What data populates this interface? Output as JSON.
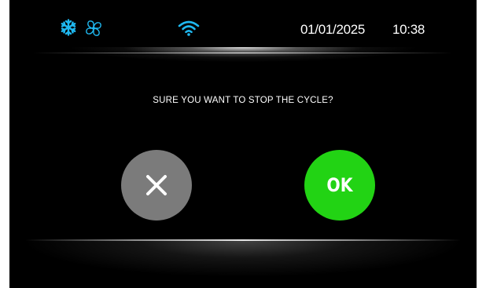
{
  "colors": {
    "background": "#000000",
    "accent_icon": "#1fb8f0",
    "cancel_button": "#7b7b7b",
    "ok_button": "#22d314",
    "text": "#ffffff"
  },
  "status_bar": {
    "icons": [
      "snowflake-icon",
      "fan-icon",
      "wifi-icon"
    ],
    "date": "01/01/2025",
    "time": "10:38"
  },
  "dialog": {
    "message": "SURE YOU WANT TO STOP THE CYCLE?",
    "cancel_icon": "close-icon",
    "ok_label": "OK"
  }
}
